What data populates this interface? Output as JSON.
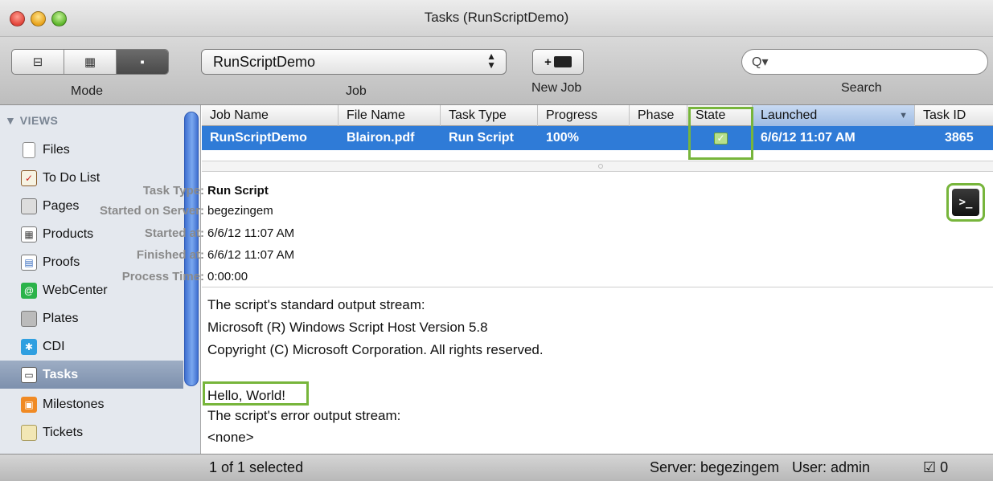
{
  "window": {
    "title": "Tasks (RunScriptDemo)"
  },
  "toolbar": {
    "mode_label": "Mode",
    "mode_buttons": [
      "⊟",
      "▦",
      "▪"
    ],
    "job_label": "Job",
    "job_value": "RunScriptDemo",
    "new_job_label": "New Job",
    "new_job_icon": "+",
    "search_label": "Search",
    "search_icon": "Q▾",
    "search_value": ""
  },
  "sidebar": {
    "header": "▼ VIEWS",
    "items": [
      {
        "label": "Files",
        "icon": "file-icon"
      },
      {
        "label": "To Do List",
        "icon": "todo-list-icon"
      },
      {
        "label": "Pages",
        "icon": "pages-icon"
      },
      {
        "label": "Products",
        "icon": "products-icon"
      },
      {
        "label": "Proofs",
        "icon": "proofs-icon"
      },
      {
        "label": "WebCenter",
        "icon": "webcenter-icon"
      },
      {
        "label": "Plates",
        "icon": "plates-icon"
      },
      {
        "label": "CDI",
        "icon": "cdi-icon"
      },
      {
        "label": "Tasks",
        "icon": "tasks-icon"
      },
      {
        "label": "Milestones",
        "icon": "milestones-icon"
      },
      {
        "label": "Tickets",
        "icon": "tickets-icon"
      }
    ],
    "selected": "Tasks"
  },
  "table": {
    "columns": [
      "Job Name",
      "File Name",
      "Task Type",
      "Progress",
      "Phase",
      "State",
      "Launched",
      "Task ID"
    ],
    "rows": [
      {
        "job_name": "RunScriptDemo",
        "file_name": "Blairon.pdf",
        "task_type": "Run Script",
        "progress": "100%",
        "phase": "",
        "state": "✓",
        "launched": "6/6/12 11:07 AM",
        "task_id": "3865"
      }
    ]
  },
  "details": {
    "fields": [
      {
        "label": "Task Type:",
        "value": "Run Script"
      },
      {
        "label": "Started on Server:",
        "value": "begezingem"
      },
      {
        "label": "Started at:",
        "value": "6/6/12 11:07 AM"
      },
      {
        "label": "Finished at:",
        "value": "6/6/12 11:07 AM"
      },
      {
        "label": "Process Time:",
        "value": "0:00:00"
      }
    ],
    "terminal_icon": ">_"
  },
  "output": {
    "lines": [
      "The script's standard output stream:",
      "Microsoft (R) Windows Script Host Version 5.8",
      "Copyright (C) Microsoft Corporation. All rights reserved.",
      "",
      "Hello, World!",
      "The script's error output stream:",
      "<none>"
    ]
  },
  "status": {
    "selection": "1 of 1 selected",
    "server": "Server: begezingem",
    "user": "User: admin",
    "todo_icon": "☑",
    "todo_count": "0"
  },
  "colors": {
    "selection_blue": "#2f7bd7",
    "highlight_green": "#77b53b",
    "sidebar_bg": "#e4e8ee"
  }
}
